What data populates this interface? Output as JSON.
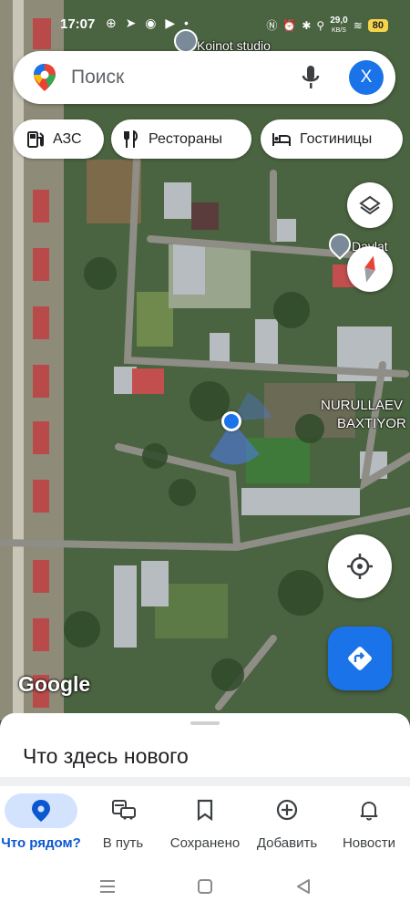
{
  "status_bar": {
    "time": "17:07",
    "icons": [
      "location-icon",
      "telegram-icon",
      "chat-icon",
      "youtube-icon",
      "dot-icon"
    ],
    "network_speed": "29,0",
    "network_unit": "KB/S",
    "battery": "80"
  },
  "map": {
    "labels": {
      "top_place": "Koinot studio",
      "right_place": "Davlat",
      "person_line1": "NURULLAEV",
      "person_line2": "BAXTIYOR"
    },
    "attribution": "Google"
  },
  "search": {
    "placeholder": "Поиск",
    "avatar_letter": "X"
  },
  "chips": [
    {
      "label": "АЗС",
      "icon": "gas-station-icon"
    },
    {
      "label": "Рестораны",
      "icon": "restaurant-icon"
    },
    {
      "label": "Гостиницы",
      "icon": "hotel-icon"
    }
  ],
  "sheet": {
    "title": "Что здесь нового"
  },
  "bottom_nav": [
    {
      "label": "Что рядом?",
      "icon": "explore-pin-icon",
      "active": true
    },
    {
      "label": "В путь",
      "icon": "commute-icon",
      "active": false
    },
    {
      "label": "Сохранено",
      "icon": "bookmark-icon",
      "active": false
    },
    {
      "label": "Добавить",
      "icon": "add-circle-icon",
      "active": false
    },
    {
      "label": "Новости",
      "icon": "bell-icon",
      "active": false
    }
  ],
  "colors": {
    "accent": "#1a73e8",
    "active_pill": "#d3e3fd",
    "active_text": "#0b57d0"
  }
}
